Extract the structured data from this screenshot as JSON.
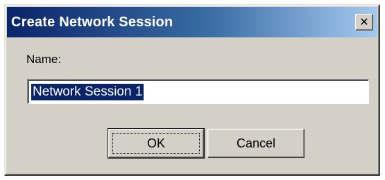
{
  "window": {
    "title": "Create Network Session",
    "close_icon": "close-icon"
  },
  "form": {
    "name_label": "Name:",
    "name_value": "Network Session 1"
  },
  "buttons": {
    "ok_label": "OK",
    "cancel_label": "Cancel"
  },
  "colors": {
    "titlebar_start": "#0a246a",
    "titlebar_end": "#a6caf0",
    "dialog_face": "#d4d0c8",
    "selection": "#0a246a"
  }
}
